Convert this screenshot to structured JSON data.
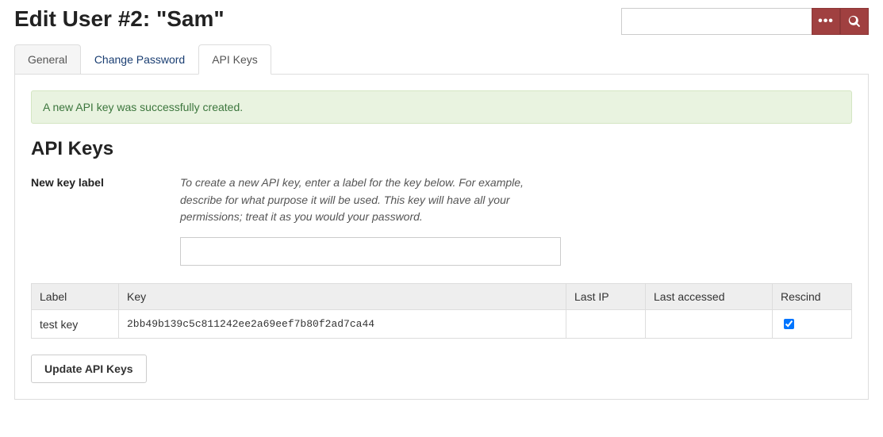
{
  "header": {
    "title": "Edit User #2: \"Sam\""
  },
  "search": {
    "value": "",
    "placeholder": ""
  },
  "tabs": [
    {
      "label": "General"
    },
    {
      "label": "Change Password"
    },
    {
      "label": "API Keys"
    }
  ],
  "alert": {
    "message": "A new API key was successfully created."
  },
  "section": {
    "title": "API Keys"
  },
  "form": {
    "label": "New key label",
    "help": "To create a new API key, enter a label for the key below. For example, describe for what purpose it will be used. This key will have all your permissions; treat it as you would your password.",
    "value": ""
  },
  "table": {
    "headers": {
      "label": "Label",
      "key": "Key",
      "last_ip": "Last IP",
      "last_accessed": "Last accessed",
      "rescind": "Rescind"
    },
    "rows": [
      {
        "label": "test key",
        "key": "2bb49b139c5c811242ee2a69eef7b80f2ad7ca44",
        "last_ip": "",
        "last_accessed": "",
        "rescind": true
      }
    ]
  },
  "buttons": {
    "update": "Update API Keys"
  }
}
